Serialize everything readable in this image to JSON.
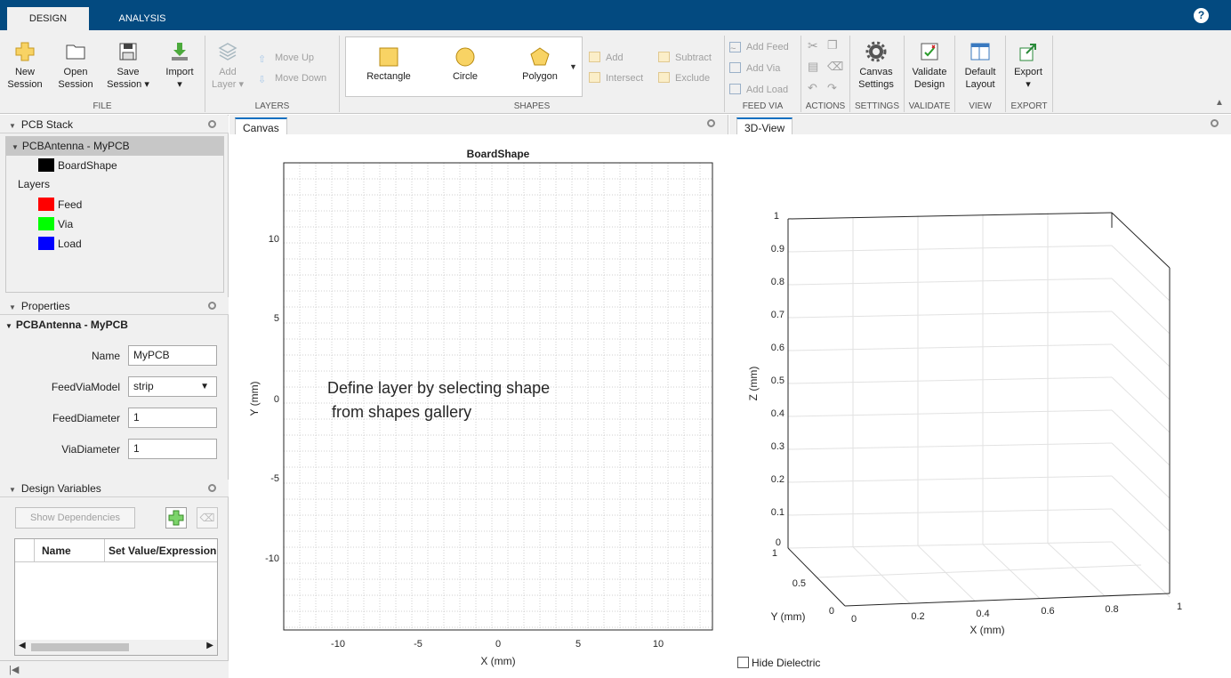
{
  "tabs": {
    "design": "DESIGN",
    "analysis": "ANALYSIS",
    "help": "?"
  },
  "ribbon": {
    "file": {
      "new": [
        "New",
        "Session"
      ],
      "open": [
        "Open",
        "Session"
      ],
      "save": [
        "Save",
        "Session ▾"
      ],
      "import": [
        "Import",
        "▾"
      ],
      "group": "FILE"
    },
    "layers": {
      "add": [
        "Add",
        "Layer ▾"
      ],
      "move_up": "Move Up",
      "move_down": "Move Down",
      "group": "LAYERS"
    },
    "shapes": {
      "items": [
        "Rectangle",
        "Circle",
        "Polygon"
      ],
      "add": "Add",
      "subtract": "Subtract",
      "intersect": "Intersect",
      "exclude": "Exclude",
      "group": "SHAPES"
    },
    "feedvia": {
      "add_feed": "Add Feed",
      "add_via": "Add Via",
      "add_load": "Add Load",
      "group": "FEED VIA"
    },
    "actions": {
      "group": "ACTIONS"
    },
    "settings": {
      "btn": [
        "Canvas",
        "Settings"
      ],
      "group": "SETTINGS"
    },
    "validate": {
      "btn": [
        "Validate",
        "Design"
      ],
      "group": "VALIDATE"
    },
    "view": {
      "btn": [
        "Default",
        "Layout"
      ],
      "group": "VIEW"
    },
    "export": {
      "btn": [
        "Export",
        "▾"
      ],
      "group": "EXPORT"
    }
  },
  "pcb_stack": {
    "title": "PCB Stack",
    "root": "PCBAntenna - MyPCB",
    "board": "BoardShape",
    "layers_label": "Layers",
    "layers": [
      {
        "name": "Feed",
        "color": "#ff0000"
      },
      {
        "name": "Via",
        "color": "#00ff00"
      },
      {
        "name": "Load",
        "color": "#0000ff"
      }
    ],
    "board_color": "#000000"
  },
  "properties": {
    "title": "Properties",
    "object": "PCBAntenna - MyPCB",
    "fields": [
      {
        "label": "Name",
        "value": "MyPCB"
      },
      {
        "label": "FeedViaModel",
        "value": "strip"
      },
      {
        "label": "FeedDiameter",
        "value": "1"
      },
      {
        "label": "ViaDiameter",
        "value": "1"
      }
    ]
  },
  "design_variables": {
    "title": "Design Variables",
    "show_dependencies": "Show Dependencies",
    "columns": [
      "Name",
      "Set Value/Expression"
    ]
  },
  "canvas": {
    "tab": "Canvas",
    "title": "BoardShape",
    "xlabel": "X (mm)",
    "ylabel": "Y (mm)",
    "xticks": [
      "-10",
      "-5",
      "0",
      "5",
      "10"
    ],
    "yticks": [
      "10",
      "5",
      "0",
      "-5",
      "-10"
    ],
    "message": [
      "Define layer by selecting shape",
      "from shapes gallery"
    ]
  },
  "view3d": {
    "tab": "3D-View",
    "xlabel": "X (mm)",
    "ylabel": "Y (mm)",
    "zlabel": "Z (mm)",
    "zticks": [
      "1",
      "0.9",
      "0.8",
      "0.7",
      "0.6",
      "0.5",
      "0.4",
      "0.3",
      "0.2",
      "0.1",
      "0"
    ],
    "xticks": [
      "0",
      "0.2",
      "0.4",
      "0.6",
      "0.8",
      "1"
    ],
    "yticks": [
      "1",
      "0.5",
      "0"
    ],
    "hide_dielectric": "Hide Dielectric"
  }
}
